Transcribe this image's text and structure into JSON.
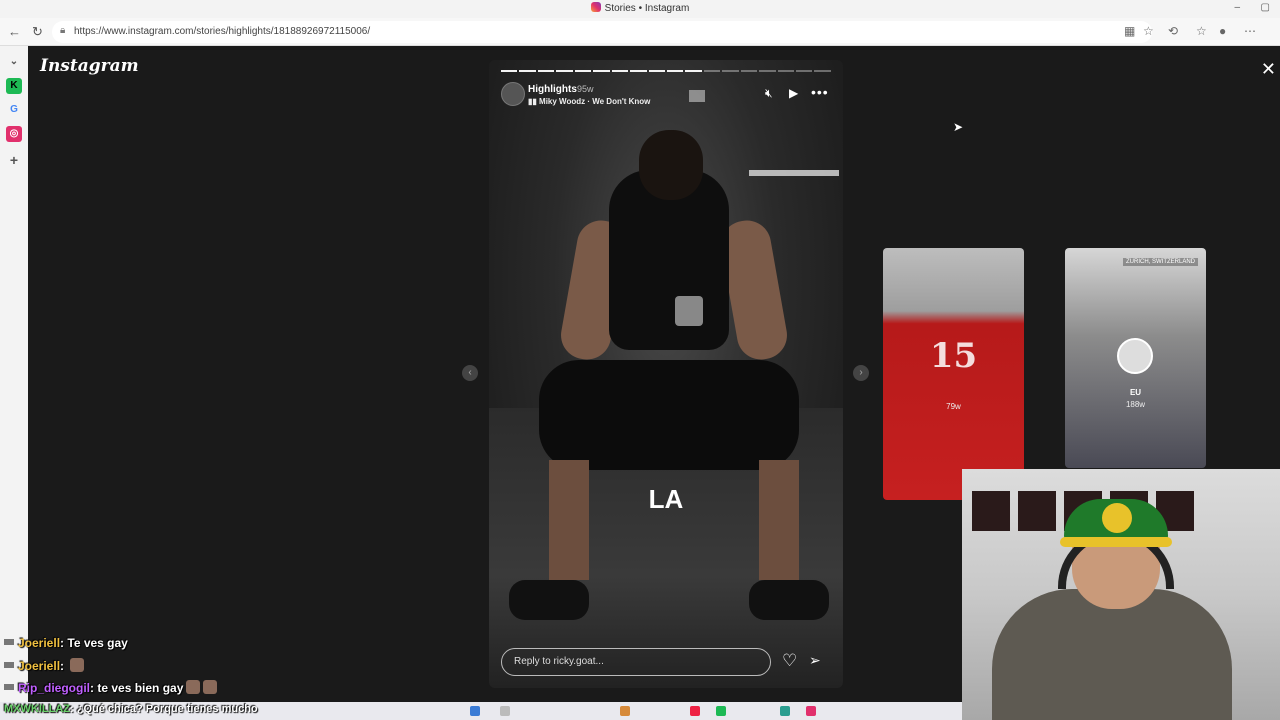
{
  "browser": {
    "tab_title": "Stories • Instagram",
    "url": "https://www.instagram.com/stories/highlights/18188926972115006/",
    "min_glyph": "–",
    "max_glyph": "▢",
    "back_glyph": "←",
    "reload_glyph": "↻",
    "sidebar_add_glyph": "+",
    "sidebar_k_glyph": "K",
    "sidebar_g_glyph": "G"
  },
  "instagram": {
    "logo": "Instagram",
    "close_glyph": "✕",
    "story": {
      "highlight_name": "Highlights",
      "age": "95w",
      "music": "Miky Woodz · We Don't Know",
      "caption": "LA",
      "reply_placeholder": "Reply to ricky.goat...",
      "progress_total": 18,
      "progress_done": 11
    },
    "previews": [
      {
        "label": "",
        "age": "79w",
        "number": "15"
      },
      {
        "label": "EU",
        "age": "188w",
        "tag": "ZURICH, SWITZERLAND"
      }
    ]
  },
  "chat": {
    "lines": [
      {
        "user": "Joeriell",
        "sep": ": ",
        "message": "Te ves gay"
      },
      {
        "user": "Joeriell",
        "sep": ": ",
        "message": ""
      },
      {
        "user": "Rip_diegogil",
        "sep": ": ",
        "message": "te ves bien gay"
      }
    ],
    "ticker": {
      "user": "MXWKILLAZ",
      "sep": ": ",
      "message": "¿Qué chica? Porque tienes mucho"
    }
  },
  "colors": {
    "stage": "#1a1a1a",
    "chat_user_yellow": "#f0c040",
    "chat_user_purple": "#c060ff"
  }
}
